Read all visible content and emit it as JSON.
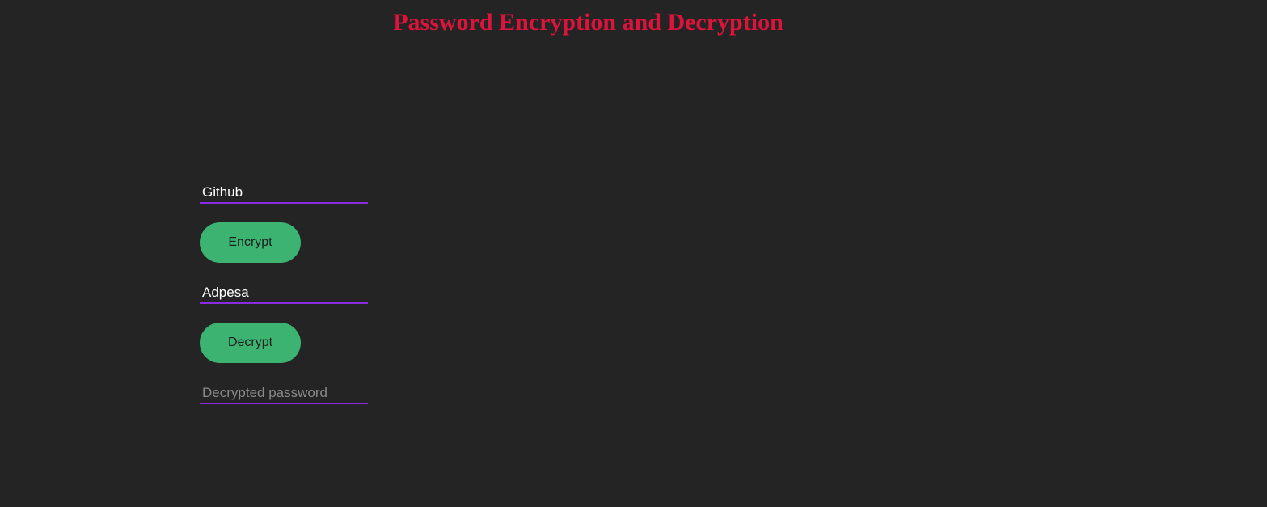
{
  "header": {
    "title": "Password Encryption and Decryption"
  },
  "form": {
    "encrypt_input": {
      "value": "Github",
      "placeholder": ""
    },
    "encrypt_button_label": "Encrypt",
    "decrypt_input": {
      "value": "Adpesa",
      "placeholder": ""
    },
    "decrypt_button_label": "Decrypt",
    "decrypted_output": {
      "value": "",
      "placeholder": "Decrypted password"
    }
  },
  "colors": {
    "background": "#242424",
    "title": "#dc143c",
    "button": "#3cb371",
    "input_underline": "#8a2be2"
  }
}
